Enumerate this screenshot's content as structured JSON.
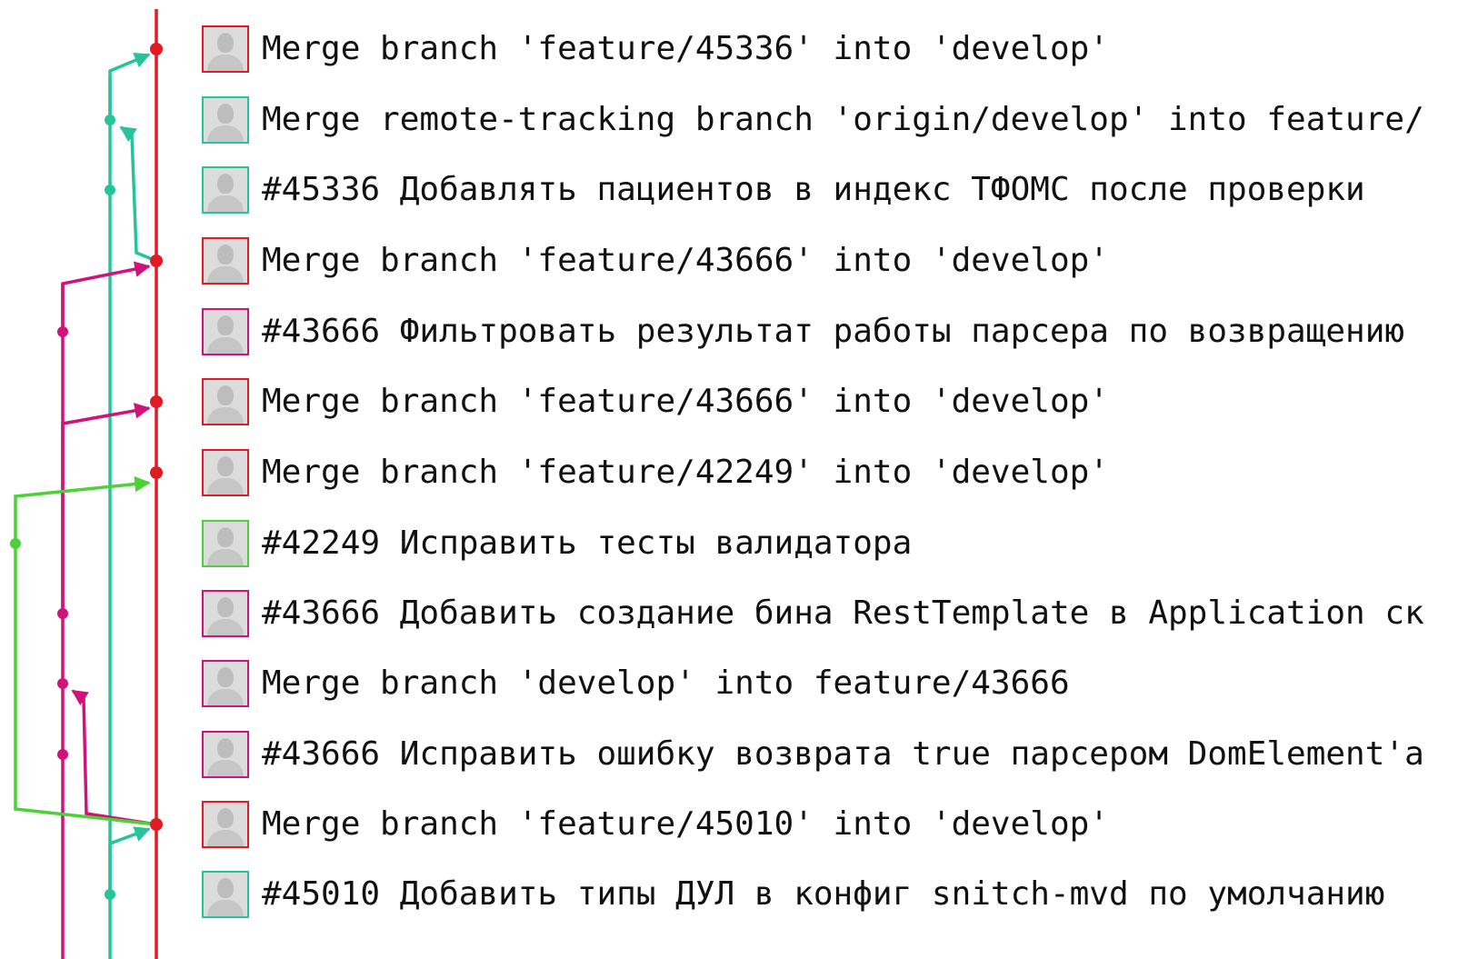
{
  "graph": {
    "colors": {
      "main": "#e01b24",
      "teal": "#26c49a",
      "magenta": "#d0137a",
      "green": "#4cd137"
    }
  },
  "commits": [
    {
      "message": "Merge branch 'feature/45336' into 'develop'",
      "color": "#e01b24"
    },
    {
      "message": "Merge remote-tracking branch 'origin/develop' into feature/",
      "color": "#26c49a"
    },
    {
      "message": "#45336 Добавлять пациентов в индекс ТФОМС после проверки",
      "color": "#26c49a"
    },
    {
      "message": "Merge branch 'feature/43666' into 'develop'",
      "color": "#e01b24"
    },
    {
      "message": "#43666 Фильтровать результат работы парсера по возвращению",
      "color": "#d0137a"
    },
    {
      "message": "Merge branch 'feature/43666' into 'develop'",
      "color": "#e01b24"
    },
    {
      "message": "Merge branch 'feature/42249' into 'develop'",
      "color": "#e01b24"
    },
    {
      "message": "#42249 Исправить тесты валидатора",
      "color": "#4cd137"
    },
    {
      "message": "#43666 Добавить создание бина RestTemplate в Application ск",
      "color": "#d0137a"
    },
    {
      "message": "Merge branch 'develop' into feature/43666",
      "color": "#d0137a"
    },
    {
      "message": "#43666 Исправить ошибку возврата true парсером DomElement'а",
      "color": "#d0137a"
    },
    {
      "message": "Merge branch 'feature/45010' into 'develop'",
      "color": "#e01b24"
    },
    {
      "message": "#45010 Добавить типы ДУЛ в конфиг snitch-mvd по умолчанию",
      "color": "#26c49a"
    }
  ]
}
